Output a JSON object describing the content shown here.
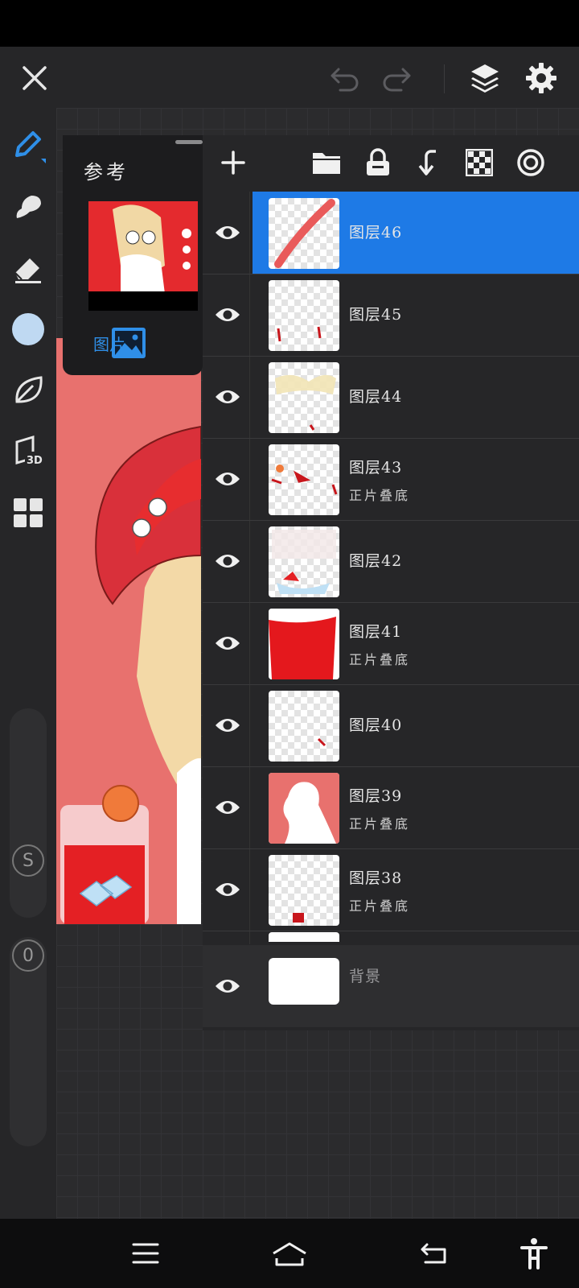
{
  "top_bar": {
    "close_icon": "close-icon",
    "undo_icon": "undo-icon",
    "redo_icon": "redo-icon",
    "layers_icon": "layers-icon",
    "settings_icon": "gear-icon"
  },
  "left_tools": [
    {
      "name": "brush-icon"
    },
    {
      "name": "smudge-icon"
    },
    {
      "name": "eraser-icon"
    },
    {
      "name": "color-swatch",
      "color": "#bfd9f2"
    },
    {
      "name": "leaf-icon"
    },
    {
      "name": "3d-icon",
      "label": "3D"
    },
    {
      "name": "grid-icon"
    }
  ],
  "sliders": {
    "size_label": "S",
    "opacity_label": "0"
  },
  "reference": {
    "title": "参考",
    "image_label": "图片"
  },
  "layer_toolbar": [
    "add-icon",
    "folder-icon",
    "lock-icon",
    "merge-down-icon",
    "checker-icon",
    "target-icon"
  ],
  "layers": [
    {
      "name": "图层46",
      "blend": "",
      "selected": true
    },
    {
      "name": "图层45",
      "blend": ""
    },
    {
      "name": "图层44",
      "blend": ""
    },
    {
      "name": "图层43",
      "blend": "正片叠底"
    },
    {
      "name": "图层42",
      "blend": ""
    },
    {
      "name": "图层41",
      "blend": "正片叠底"
    },
    {
      "name": "图层40",
      "blend": ""
    },
    {
      "name": "图层39",
      "blend": "正片叠底"
    },
    {
      "name": "图层38",
      "blend": "正片叠底"
    }
  ],
  "background_layer": {
    "name": "背景"
  },
  "colors": {
    "accent": "#1e7ae6",
    "canvas_bg": "#e8716e",
    "panel": "#262628"
  }
}
